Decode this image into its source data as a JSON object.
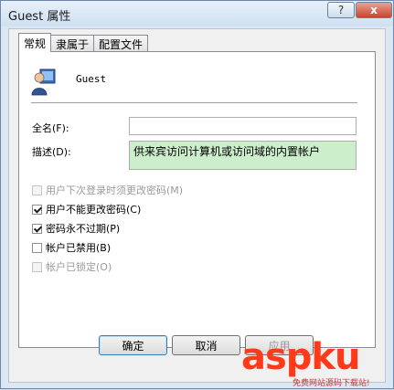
{
  "window": {
    "title": "Guest 属性"
  },
  "titlebar": {
    "help_glyph": "?",
    "close_glyph": "x"
  },
  "tabs": [
    {
      "label": "常规",
      "active": true
    },
    {
      "label": "隶属于",
      "active": false
    },
    {
      "label": "配置文件",
      "active": false
    }
  ],
  "user": {
    "name": "Guest"
  },
  "fields": {
    "fullname_label": "全名(F):",
    "fullname_value": "",
    "description_label": "描述(D):",
    "description_value": "供来宾访问计算机或访问域的内置帐户"
  },
  "checkboxes": [
    {
      "label": "用户下次登录时须更改密码(M)",
      "checked": false,
      "enabled": false
    },
    {
      "label": "用户不能更改密码(C)",
      "checked": true,
      "enabled": true
    },
    {
      "label": "密码永不过期(P)",
      "checked": true,
      "enabled": true
    },
    {
      "label": "帐户已禁用(B)",
      "checked": false,
      "enabled": true
    },
    {
      "label": "帐户已锁定(O)",
      "checked": false,
      "enabled": false
    }
  ],
  "buttons": {
    "ok": "确定",
    "cancel": "取消",
    "apply": "应用"
  },
  "watermark": {
    "brand": "aspku",
    "tagline": "免费网站源码下载站!"
  },
  "colors": {
    "description_bg": "#cdeecb",
    "close_button": "#c7452e",
    "watermark": "#ff3a1a"
  }
}
